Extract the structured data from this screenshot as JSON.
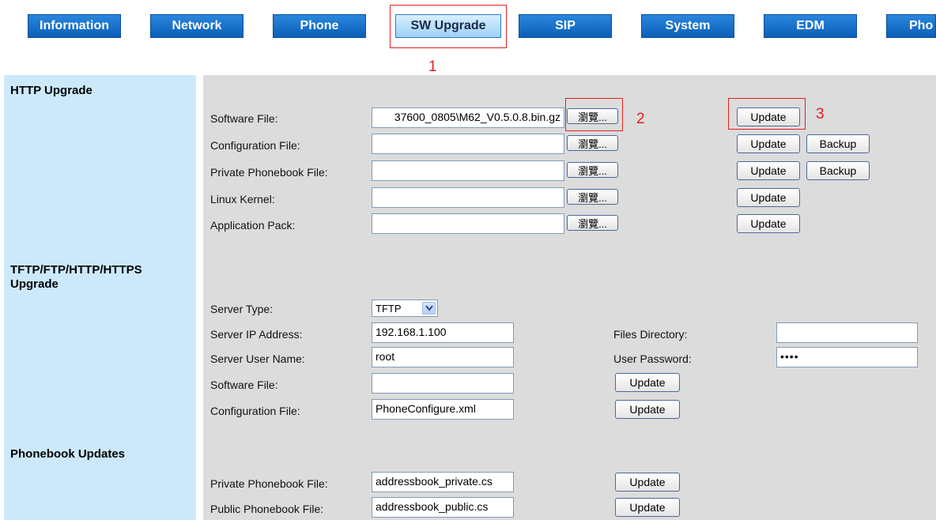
{
  "nav": {
    "tabs": [
      {
        "label": "Information"
      },
      {
        "label": "Network"
      },
      {
        "label": "Phone"
      },
      {
        "label": "SW Upgrade"
      },
      {
        "label": "SIP"
      },
      {
        "label": "System"
      },
      {
        "label": "EDM"
      },
      {
        "label": "Pho"
      }
    ],
    "active_tab": "SW Upgrade"
  },
  "annotations": {
    "n1": "1",
    "n2": "2",
    "n3": "3"
  },
  "http_upgrade": {
    "title": "HTTP Upgrade",
    "browse_label": "瀏覽...",
    "rows": [
      {
        "label": "Software File:",
        "value": "37600_0805\\M62_V0.5.0.8.bin.gz",
        "update": "Update"
      },
      {
        "label": "Configuration File:",
        "value": "",
        "update": "Update",
        "backup": "Backup"
      },
      {
        "label": "Private Phonebook File:",
        "value": "",
        "update": "Update",
        "backup": "Backup"
      },
      {
        "label": "Linux Kernel:",
        "value": "",
        "update": "Update"
      },
      {
        "label": "Application Pack:",
        "value": "",
        "update": "Update"
      }
    ]
  },
  "tftp_upgrade": {
    "title_line1": "TFTP/FTP/HTTP/HTTPS",
    "title_line2": "Upgrade",
    "server_type_label": "Server Type:",
    "server_type_value": "TFTP",
    "server_ip_label": "Server IP Address:",
    "server_ip_value": "192.168.1.100",
    "files_dir_label": "Files Directory:",
    "files_dir_value": "",
    "user_name_label": "Server User Name:",
    "user_name_value": "root",
    "password_label": "User Password:",
    "password_value": "••••",
    "software_label": "Software File:",
    "software_value": "",
    "config_label": "Configuration File:",
    "config_value": "PhoneConfigure.xml",
    "update": "Update"
  },
  "phonebook_updates": {
    "title": "Phonebook Updates",
    "private_label": "Private Phonebook File:",
    "private_value": "addressbook_private.cs",
    "public_label": "Public Phonebook File:",
    "public_value": "addressbook_public.cs",
    "update": "Update"
  }
}
